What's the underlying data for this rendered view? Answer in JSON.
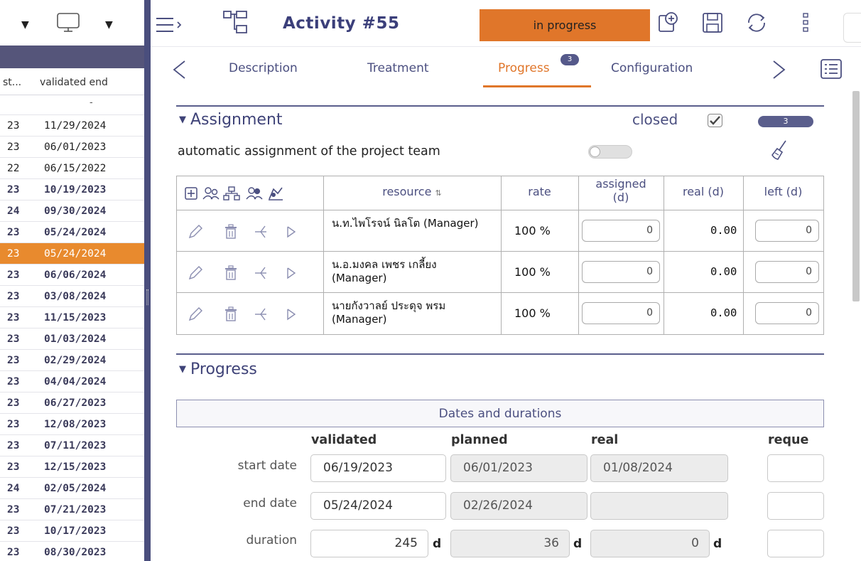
{
  "left_list": {
    "header_col1": "st...",
    "header_col2": "validated end",
    "filter_placeholder": "-",
    "rows": [
      {
        "a": "23",
        "b": "11/29/2024",
        "style": "light"
      },
      {
        "a": "23",
        "b": "06/01/2023",
        "style": "light"
      },
      {
        "a": "22",
        "b": "06/15/2022",
        "style": "light"
      },
      {
        "a": "23",
        "b": "10/19/2023",
        "style": "bold"
      },
      {
        "a": "24",
        "b": "09/30/2024",
        "style": "bold"
      },
      {
        "a": "23",
        "b": "05/24/2024",
        "style": "bold"
      },
      {
        "a": "23",
        "b": "05/24/2024",
        "style": "selected"
      },
      {
        "a": "23",
        "b": "06/06/2024",
        "style": "bold"
      },
      {
        "a": "23",
        "b": "03/08/2024",
        "style": "bold"
      },
      {
        "a": "23",
        "b": "11/15/2023",
        "style": "bold"
      },
      {
        "a": "23",
        "b": "01/03/2024",
        "style": "bold"
      },
      {
        "a": "23",
        "b": "02/29/2024",
        "style": "bold"
      },
      {
        "a": "23",
        "b": "04/04/2024",
        "style": "bold"
      },
      {
        "a": "23",
        "b": "06/27/2023",
        "style": "bold"
      },
      {
        "a": "23",
        "b": "12/08/2023",
        "style": "bold"
      },
      {
        "a": "23",
        "b": "07/11/2023",
        "style": "bold"
      },
      {
        "a": "23",
        "b": "12/15/2023",
        "style": "bold"
      },
      {
        "a": "24",
        "b": "02/05/2024",
        "style": "bold"
      },
      {
        "a": "23",
        "b": "07/21/2023",
        "style": "bold"
      },
      {
        "a": "23",
        "b": "10/17/2023",
        "style": "bold"
      },
      {
        "a": "23",
        "b": "08/30/2023",
        "style": "bold"
      }
    ]
  },
  "header": {
    "title": "Activity  #55",
    "status": "in progress"
  },
  "tabs": {
    "items": [
      "Description",
      "Treatment",
      "Progress",
      "Configuration"
    ],
    "active": "Progress",
    "progress_badge": "3"
  },
  "assignment": {
    "title": "Assignment",
    "closed_label": "closed",
    "count_badge": "3",
    "auto_label": "automatic assignment of the project team",
    "columns": {
      "resource": "resource",
      "sort_icon": "⇅",
      "rate": "rate",
      "assigned": "assigned\n(d)",
      "real": "real (d)",
      "left": "left (d)"
    },
    "rows": [
      {
        "resource": "น.ท.ไพโรจน์ นิลโต (Manager)",
        "rate": "100 %",
        "assigned": "0",
        "real": "0.00",
        "left": "0"
      },
      {
        "resource": "น.อ.มงคล เพชร เกลี้ยง (Manager)",
        "rate": "100 %",
        "assigned": "0",
        "real": "0.00",
        "left": "0"
      },
      {
        "resource": "นายกังวาลย์ ประดุจ พรม (Manager)",
        "rate": "100 %",
        "assigned": "0",
        "real": "0.00",
        "left": "0"
      }
    ]
  },
  "progress": {
    "title": "Progress",
    "dates_box": "Dates and durations",
    "col_validated": "validated",
    "col_planned": "planned",
    "col_real": "real",
    "col_requested": "reque",
    "start_label": "start date",
    "end_label": "end date",
    "duration_label": "duration",
    "start_validated": "06/19/2023",
    "start_planned": "06/01/2023",
    "start_real": "01/08/2024",
    "end_validated": "05/24/2024",
    "end_planned": "02/26/2024",
    "end_real": "",
    "dur_validated": "245",
    "dur_planned": "36",
    "dur_real": "0",
    "unit": "d"
  },
  "colors": {
    "accent": "#e0762a",
    "primary": "#4b4f80",
    "band": "#55557a"
  }
}
